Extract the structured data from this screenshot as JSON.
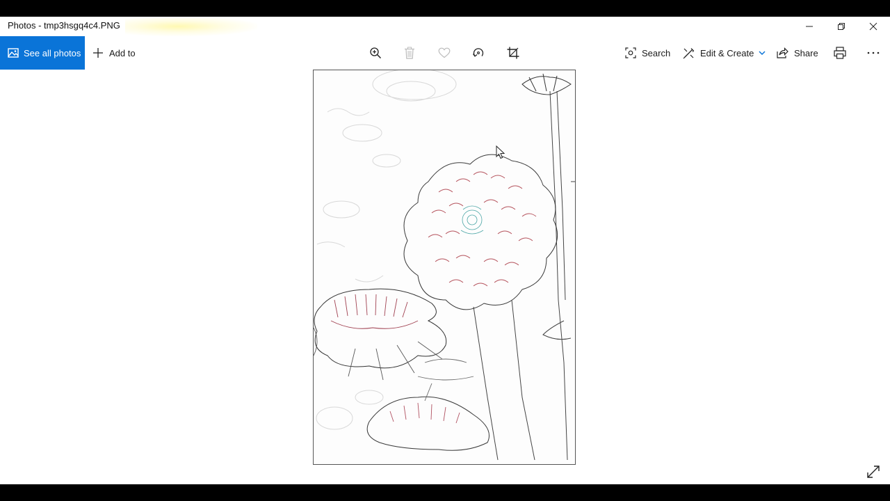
{
  "window": {
    "title": "Photos - tmp3hsgq4c4.PNG"
  },
  "toolbar": {
    "see_all_label": "See all photos",
    "add_to_label": "Add to",
    "search_label": "Search",
    "edit_create_label": "Edit & Create",
    "share_label": "Share"
  },
  "photo": {
    "description_icon": "image-thumb-icon"
  },
  "colors": {
    "accent": "#0a74d8",
    "background": "#ffffff",
    "frame": "#000000"
  }
}
